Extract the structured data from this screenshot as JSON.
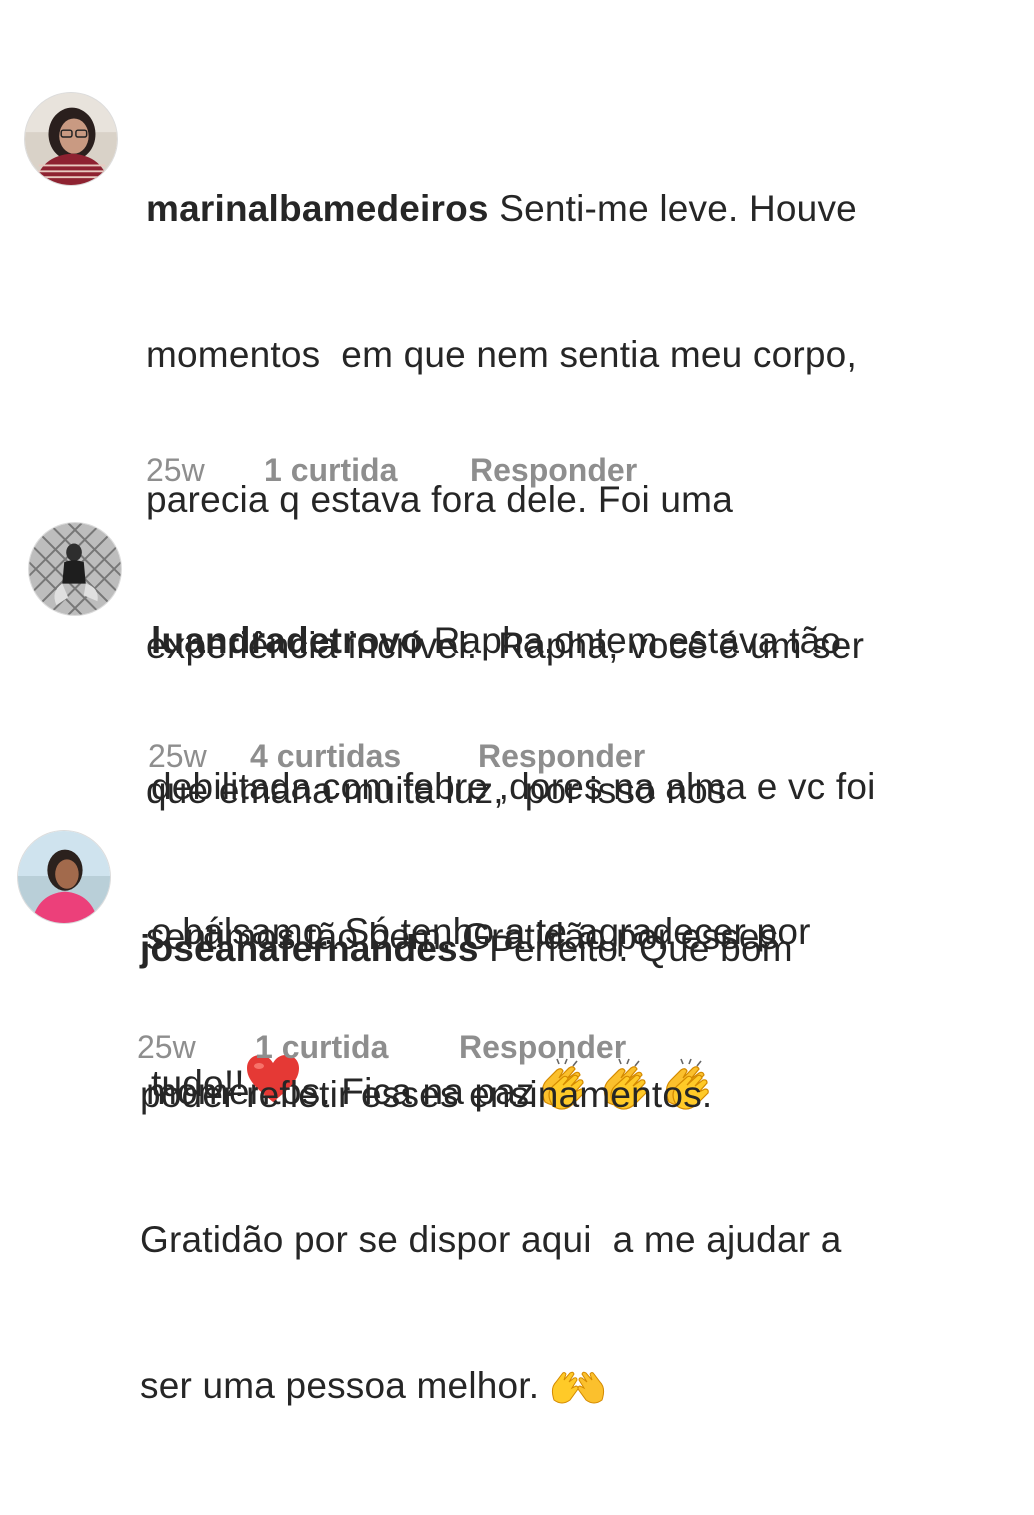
{
  "comments": [
    {
      "username": "marinalbamedeiros",
      "lines": [
        " Senti-me leve. Houve",
        "momentos  em que nem sentia meu corpo,",
        "parecia q estava fora dele. Foi uma",
        "experiência incrível.  Rapha, você é um ser",
        "que emana muita luz,  por isso nos",
        "sentimos tão bem. Gratidão por esses",
        "momentos. Fica na paz"
      ],
      "emoji": "clapping-hands x3",
      "time": "25w",
      "likes": "1 curtida",
      "reply": "Responder"
    },
    {
      "username": "luandradetrovo",
      "lines": [
        " Rapha,ontem estava tão",
        "debilitada com febre ,dores na alma e vc foi",
        "o bálsamo. Só tenho a te agradecer por",
        "tudo!!"
      ],
      "emoji": "red-heart",
      "time": "25w",
      "likes": "4 curtidas",
      "reply": "Responder"
    },
    {
      "username": "joseanafernandess",
      "lines": [
        " Perfeito. Que bom",
        "poder refletir esses ensinamentos.",
        "Gratidão por se dispor aqui  a me ajudar a",
        "ser uma pessoa melhor. "
      ],
      "emoji": "raising-hands",
      "time": "25w",
      "likes": "1 curtida",
      "reply": "Responder"
    }
  ]
}
